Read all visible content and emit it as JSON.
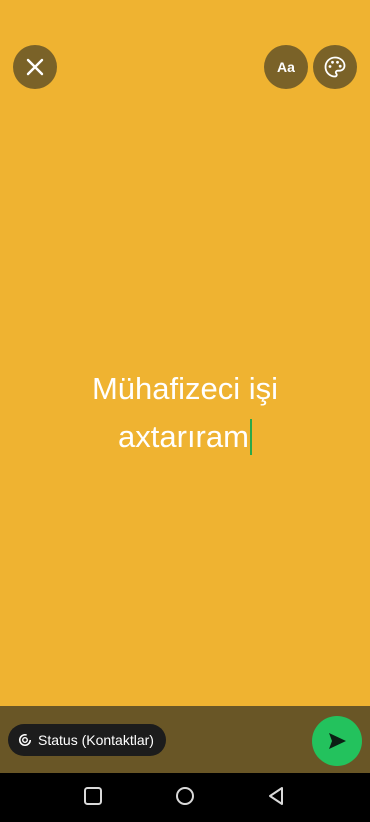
{
  "composer": {
    "line1": "Mühafizeci işi",
    "line2": "axtarıram"
  },
  "toolbar": {
    "font_label": "Aa",
    "close_icon": "close-icon",
    "palette_icon": "palette-icon"
  },
  "footer": {
    "audience_label": "Status (Kontaktlar)",
    "audience_icon": "status-icon",
    "send_icon": "send-icon"
  },
  "navigation": {
    "items": [
      "recents-icon",
      "home-icon",
      "back-icon"
    ]
  },
  "colors": {
    "background": "#EFB331",
    "button_overlay": "#7A6228",
    "bottom_bar": "#695626",
    "send": "#23C25D",
    "cursor": "#2BA84A"
  }
}
